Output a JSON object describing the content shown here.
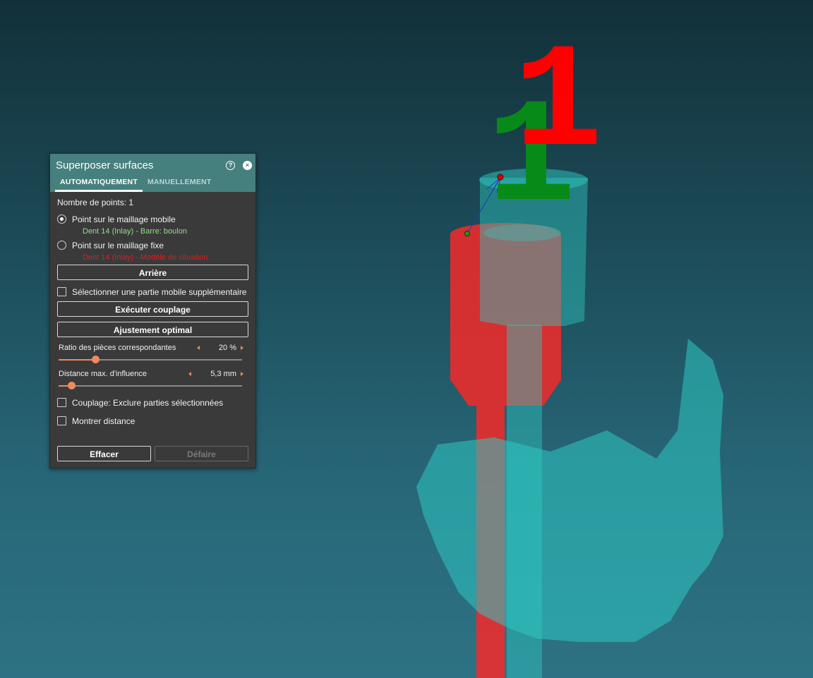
{
  "scene": {
    "label_red": "1",
    "label_green": "1",
    "colors": {
      "red_mesh": "#ee2b2b",
      "teal_mesh": "#2ec8c2",
      "red_label": "#ff0000",
      "green_label": "#088a18"
    }
  },
  "panel": {
    "title": "Superposer surfaces",
    "help_icon": "?",
    "close_icon": "×",
    "tabs": [
      {
        "label": "AUTOMATIQUEMENT",
        "active": true
      },
      {
        "label": "MANUELLEMENT",
        "active": false
      }
    ],
    "points_count": "Nombre de points: 1",
    "mobile": {
      "label": "Point sur le maillage mobile",
      "selected": true,
      "detail": "Dent 14 (Inlay) - Barre: boulon",
      "detail_color": "#8fe08a"
    },
    "fixed": {
      "label": "Point sur le maillage fixe",
      "selected": false,
      "detail": "Dent 14 (Inlay) - Modèle de situation",
      "detail_color": "#e01b1b"
    },
    "back_button": "Arrière",
    "select_additional": "Sélectionner une partie mobile supplémentaire",
    "execute_button": "Exécuter couplage",
    "bestfit_button": "Ajustement optimal",
    "ratio": {
      "label": "Ratio des pièces correspondantes",
      "value": "20 %",
      "fraction": 0.2
    },
    "distance": {
      "label": "Distance max. d'influence",
      "value": "5,3 mm",
      "fraction": 0.07
    },
    "exclude_selected": "Couplage: Exclure parties sélectionnées",
    "show_distance": "Montrer distance",
    "clear_button": "Effacer",
    "undo_button": "Défaire",
    "accent": "#ee8a5e",
    "header_color": "#46807e"
  }
}
